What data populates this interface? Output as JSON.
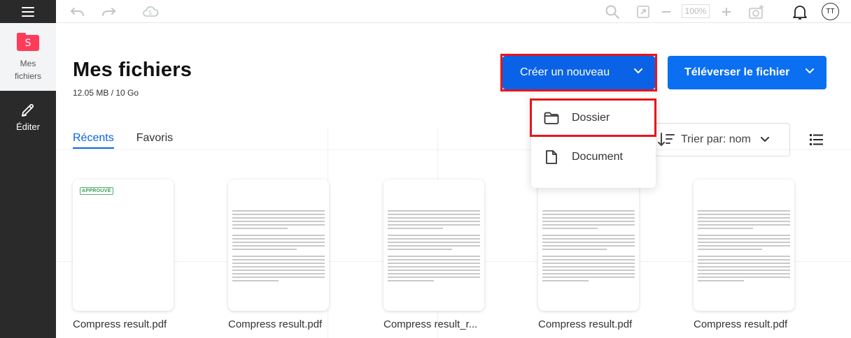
{
  "sidebar": {
    "items": [
      {
        "label": "Mes fichiers",
        "logo_letter": "S",
        "active": true
      },
      {
        "label": "Éditer",
        "active": false
      }
    ]
  },
  "toolbar": {
    "zoom": "100%",
    "avatar_initials": "TT",
    "icons": [
      "undo-icon",
      "redo-icon",
      "cloud-sync-icon",
      "search-icon",
      "fit-page-icon",
      "zoom-out-icon",
      "zoom-in-icon",
      "add-photo-icon",
      "bell-icon"
    ]
  },
  "main": {
    "title": "Mes fichiers",
    "storage": "12.05 MB / 10 Go",
    "create_button": "Créer un nouveau",
    "upload_button": "Téléverser le fichier",
    "tabs": [
      {
        "label": "Récents",
        "active": true
      },
      {
        "label": "Favoris",
        "active": false
      }
    ],
    "sort_label": "Trier par: nom",
    "dropdown": [
      {
        "label": "Dossier",
        "icon": "folder-icon"
      },
      {
        "label": "Document",
        "icon": "document-icon"
      }
    ],
    "files": [
      {
        "name": "Compress result.pdf",
        "stamp": "APPROUVÉ"
      },
      {
        "name": "Compress result.pdf",
        "stamp": ""
      },
      {
        "name": "Compress result_r...",
        "stamp": ""
      },
      {
        "name": "Compress result.pdf",
        "stamp": ""
      },
      {
        "name": "Compress result.pdf",
        "stamp": ""
      }
    ]
  },
  "colors": {
    "accent": "#0a63e6",
    "brand": "#ff3b5a",
    "highlight": "#e8141c",
    "rail": "#2a2a2a"
  }
}
